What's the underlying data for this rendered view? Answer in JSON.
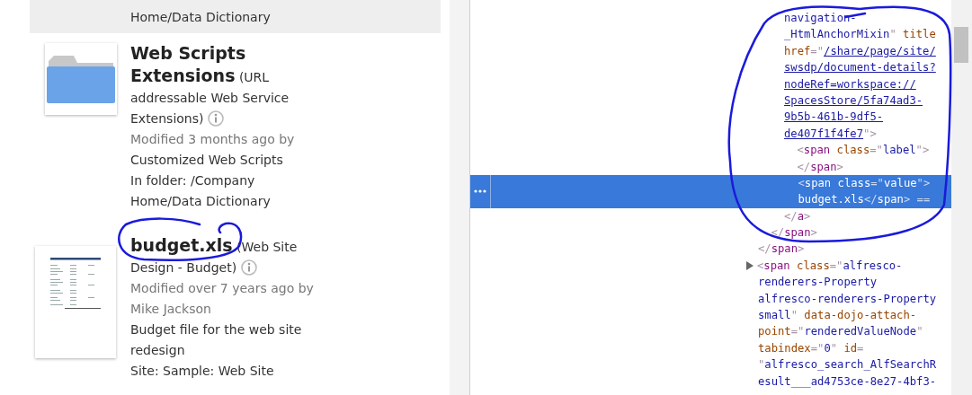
{
  "results": [
    {
      "highlighted": true,
      "lines": [
        {
          "kind": "plain",
          "text": "Home/Data Dictionary"
        }
      ]
    },
    {
      "highlighted": false,
      "kind": "folder",
      "heading": "**Web Scripts Extensions** (URL addressable Web Service Extensions)",
      "lines": [
        {
          "kind": "muted",
          "text": "Modified 3 months ago by"
        },
        {
          "kind": "plain",
          "text": "Customized Web Scripts"
        },
        {
          "kind": "plain",
          "text": "In folder: /Company Home/Data Dictionary"
        }
      ]
    },
    {
      "highlighted": false,
      "kind": "document",
      "heading": "**budget.xls** (Web Site Design - Budget)",
      "lines": [
        {
          "kind": "muted",
          "text": "Modified over 7 years ago by"
        },
        {
          "kind": "muted",
          "text": "Mike Jackson"
        },
        {
          "kind": "plain",
          "text": "Budget file for the web site redesign"
        },
        {
          "kind": "plain",
          "text": "Site: Sample: Web Site"
        }
      ]
    }
  ],
  "code": [
    {
      "selected": false,
      "kind": "open",
      "children": [
        {
          "selected": false,
          "kind": "open",
          "children": [
            {
              "selected": false,
              "kind": "open",
              "lines": [
                [
                  {
                    "kind": "value",
                    "text": "navigation-"
                  }
                ],
                [
                  {
                    "kind": "value",
                    "text": "_HtmlAnchorMixin"
                  },
                  {
                    "kind": "punct",
                    "text": "\""
                  },
                  {
                    "kind": "attr",
                    "text": " title"
                  }
                ],
                [
                  {
                    "kind": "attr",
                    "text": "href"
                  },
                  {
                    "kind": "punct",
                    "text": "=\""
                  },
                  {
                    "kind": "link",
                    "text": "/share/page/site/"
                  }
                ],
                [
                  {
                    "kind": "link",
                    "text": "swsdp/document-details?"
                  }
                ],
                [
                  {
                    "kind": "link",
                    "text": "nodeRef=workspace://"
                  }
                ],
                [
                  {
                    "kind": "link",
                    "text": "SpacesStore/5fa74ad3-"
                  }
                ],
                [
                  {
                    "kind": "link",
                    "text": "9b5b-461b-9df5-"
                  }
                ],
                [
                  {
                    "kind": "link",
                    "text": "de407f1f4fe7"
                  },
                  {
                    "kind": "punct",
                    "text": "\">"
                  }
                ]
              ],
              "children": [
                {
                  "selected": false,
                  "kind": "open",
                  "lines": [
                    [
                      {
                        "kind": "punct",
                        "text": "<"
                      },
                      {
                        "kind": "tag",
                        "text": "span"
                      },
                      {
                        "kind": "attr",
                        "text": " class"
                      },
                      {
                        "kind": "punct",
                        "text": "=\""
                      },
                      {
                        "kind": "value",
                        "text": "label"
                      },
                      {
                        "kind": "punct",
                        "text": "\">"
                      }
                    ],
                    [
                      {
                        "kind": "punct",
                        "text": "</"
                      },
                      {
                        "kind": "tag",
                        "text": "span"
                      },
                      {
                        "kind": "punct",
                        "text": ">"
                      }
                    ]
                  ]
                },
                {
                  "selected": true,
                  "kind": "open",
                  "lines": [
                    [
                      {
                        "kind": "punct",
                        "text": "<"
                      },
                      {
                        "kind": "tag",
                        "text": "span"
                      },
                      {
                        "kind": "attr",
                        "text": " class"
                      },
                      {
                        "kind": "punct",
                        "text": "=\""
                      },
                      {
                        "kind": "value",
                        "text": "value"
                      },
                      {
                        "kind": "punct",
                        "text": "\">"
                      }
                    ],
                    [
                      {
                        "kind": "text",
                        "text": "budget.xls"
                      },
                      {
                        "kind": "punct",
                        "text": "</"
                      },
                      {
                        "kind": "tag",
                        "text": "span"
                      },
                      {
                        "kind": "punct",
                        "text": ">"
                      },
                      {
                        "kind": "punct",
                        "text": " =="
                      }
                    ]
                  ]
                }
              ],
              "closing": [
                [
                  {
                    "kind": "punct",
                    "text": "</"
                  },
                  {
                    "kind": "tag",
                    "text": "a"
                  },
                  {
                    "kind": "punct",
                    "text": ">"
                  }
                ]
              ]
            }
          ],
          "closing": [
            [
              {
                "kind": "punct",
                "text": "</"
              },
              {
                "kind": "tag",
                "text": "span"
              },
              {
                "kind": "punct",
                "text": ">"
              }
            ]
          ]
        }
      ],
      "closing": [
        [
          {
            "kind": "punct",
            "text": "</"
          },
          {
            "kind": "tag",
            "text": "span"
          },
          {
            "kind": "punct",
            "text": ">"
          }
        ]
      ]
    },
    {
      "selected": false,
      "kind": "collapsed",
      "lines": [
        [
          {
            "kind": "punct",
            "text": "<"
          },
          {
            "kind": "tag",
            "text": "span"
          },
          {
            "kind": "attr",
            "text": " class"
          },
          {
            "kind": "punct",
            "text": "=\""
          },
          {
            "kind": "value",
            "text": "alfresco-"
          }
        ],
        [
          {
            "kind": "value",
            "text": "renderers-Property"
          }
        ],
        [
          {
            "kind": "value",
            "text": "alfresco-renderers-Property"
          }
        ],
        [
          {
            "kind": "value",
            "text": "small"
          },
          {
            "kind": "punct",
            "text": "\""
          },
          {
            "kind": "attr",
            "text": " data-dojo-attach-"
          }
        ],
        [
          {
            "kind": "attr",
            "text": "point"
          },
          {
            "kind": "punct",
            "text": "=\""
          },
          {
            "kind": "value",
            "text": "renderedValueNode"
          },
          {
            "kind": "punct",
            "text": "\""
          }
        ],
        [
          {
            "kind": "attr",
            "text": "tabindex"
          },
          {
            "kind": "punct",
            "text": "=\""
          },
          {
            "kind": "value",
            "text": "0"
          },
          {
            "kind": "punct",
            "text": "\""
          },
          {
            "kind": "attr",
            "text": " id"
          },
          {
            "kind": "punct",
            "text": "="
          }
        ],
        [
          {
            "kind": "punct",
            "text": "\""
          },
          {
            "kind": "value",
            "text": "alfresco_search_AlfSearchR"
          }
        ],
        [
          {
            "kind": "value",
            "text": "esult___ad4753ce-8e27-4bf3-"
          }
        ]
      ]
    }
  ],
  "annotations": [
    {
      "kind": "loop"
    },
    {
      "kind": "loop"
    }
  ]
}
